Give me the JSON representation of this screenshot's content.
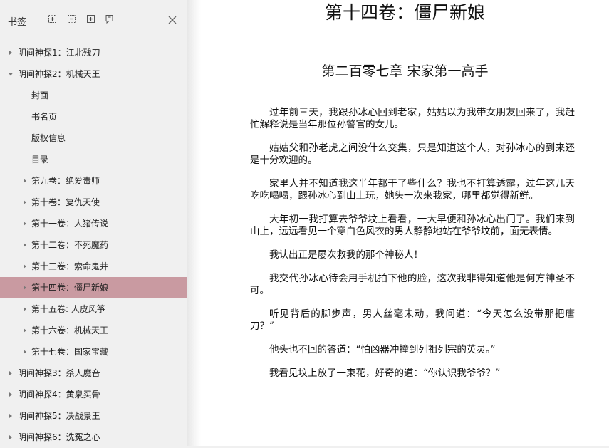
{
  "sidebar": {
    "title": "书签",
    "tools": [
      "expand-all-icon",
      "collapse-all-icon",
      "add-bookmark-icon",
      "bookmark-options-icon"
    ],
    "close_icon": "close-icon",
    "tree": [
      {
        "label": "阴间神探1：江北残刀",
        "level": 0,
        "expanded": false,
        "has_children": true
      },
      {
        "label": "阴间神探2：机械天王",
        "level": 0,
        "expanded": true,
        "has_children": true
      },
      {
        "label": "封面",
        "level": 1,
        "has_children": false
      },
      {
        "label": "书名页",
        "level": 1,
        "has_children": false
      },
      {
        "label": "版权信息",
        "level": 1,
        "has_children": false
      },
      {
        "label": "目录",
        "level": 1,
        "has_children": false
      },
      {
        "label": "第九卷：绝爱毒师",
        "level": 1,
        "has_children": true
      },
      {
        "label": "第十卷：复仇天使",
        "level": 1,
        "has_children": true
      },
      {
        "label": "第十一卷：人猪传说",
        "level": 1,
        "has_children": true
      },
      {
        "label": "第十二卷：不死魔药",
        "level": 1,
        "has_children": true
      },
      {
        "label": "第十三卷：索命鬼井",
        "level": 1,
        "has_children": true
      },
      {
        "label": "第十四卷：僵尸新娘",
        "level": 1,
        "has_children": true,
        "selected": true
      },
      {
        "label": "第十五卷: 人皮风筝",
        "level": 1,
        "has_children": true
      },
      {
        "label": "第十六卷：机械天王",
        "level": 1,
        "has_children": true
      },
      {
        "label": "第十七卷：国家宝藏",
        "level": 1,
        "has_children": true
      },
      {
        "label": "阴间神探3：杀人魔音",
        "level": 0,
        "expanded": false,
        "has_children": true
      },
      {
        "label": "阴间神探4：黄泉买骨",
        "level": 0,
        "expanded": false,
        "has_children": true
      },
      {
        "label": "阴间神探5：决战景王",
        "level": 0,
        "expanded": false,
        "has_children": true
      },
      {
        "label": "阴间神探6：洗冤之心",
        "level": 0,
        "expanded": false,
        "has_children": true
      }
    ],
    "selected_color": "#c99aa1"
  },
  "page": {
    "volume_title": "第十四卷：僵尸新娘",
    "chapter_title": "第二百零七章 宋家第一高手",
    "paragraphs": [
      "过年前三天，我跟孙冰心回到老家，姑姑以为我带女朋友回来了，我赶忙解释说是当年那位孙警官的女儿。",
      "姑姑父和孙老虎之间没什么交集，只是知道这个人，对孙冰心的到来还是十分欢迎的。",
      "家里人并不知道我这半年都干了些什么？我也不打算透露，过年这几天吃吃喝喝，跟孙冰心到山上玩，她头一次来我家，哪里都觉得新鲜。",
      "大年初一我打算去爷爷坟上看看，一大早便和孙冰心出门了。我们来到山上，远远看见一个穿白色风衣的男人静静地站在爷爷坟前，面无表情。",
      "我认出正是屡次救我的那个神秘人！",
      "我交代孙冰心待会用手机拍下他的脸，这次我非得知道他是何方神圣不可。",
      "听见背后的脚步声，男人丝毫未动，我问道：“今天怎么没带那把唐刀？”",
      "他头也不回的答道：“怕凶器冲撞到列祖列宗的英灵。”",
      "我看见坟上放了一束花，好奇的道：“你认识我爷爷？”"
    ]
  }
}
